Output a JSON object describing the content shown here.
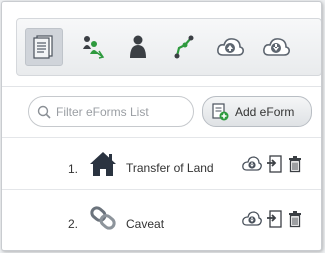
{
  "toolbar": {
    "buttons": [
      {
        "name": "eforms-list-icon",
        "active": true
      },
      {
        "name": "parties-icon",
        "active": false
      },
      {
        "name": "user-icon",
        "active": false
      },
      {
        "name": "workflow-icon",
        "active": false
      },
      {
        "name": "cloud-upload-icon",
        "active": false
      },
      {
        "name": "cloud-download-icon",
        "active": false
      }
    ]
  },
  "filter": {
    "placeholder": "Filter eForms List"
  },
  "add_button": {
    "label": "Add eForm",
    "icon": "add-form-icon"
  },
  "forms": [
    {
      "number": "1.",
      "title": "Transfer of Land",
      "icon": "house-icon"
    },
    {
      "number": "2.",
      "title": "Caveat",
      "icon": "chain-link-icon"
    }
  ],
  "row_actions": [
    "cloud-download-icon",
    "export-icon",
    "trash-icon"
  ],
  "colors": {
    "green": "#2e9a3e",
    "grey_icon": "#5e6670",
    "dark": "#3b3f44"
  }
}
